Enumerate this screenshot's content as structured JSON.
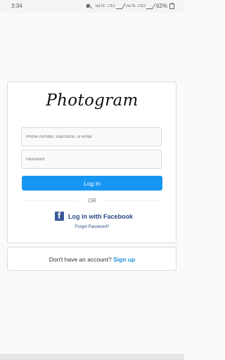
{
  "status_bar": {
    "time": "3:34",
    "network_labels": [
      "VoLTE",
      "LTE1",
      "VoLTE",
      "LTE2"
    ],
    "battery": "62%",
    "icons": [
      "mute-icon",
      "signal-icon",
      "signal-icon",
      "battery-icon"
    ]
  },
  "app": {
    "logo": "Photogram"
  },
  "login": {
    "phone_placeholder": "Phone number, username, or email",
    "password_placeholder": "Password",
    "login_button": "Log In",
    "or_text": "OR",
    "facebook_label": "Log in with Facebook",
    "forgot_password": "Forgot Password?"
  },
  "signup": {
    "prompt": "Don't have an account?",
    "link": "Sign up"
  },
  "colors": {
    "background": "#fafafa",
    "primary_blue": "#1796f2",
    "facebook_blue": "#3b5998",
    "signup_blue": "#1a91da",
    "border": "#dbdbdb"
  }
}
